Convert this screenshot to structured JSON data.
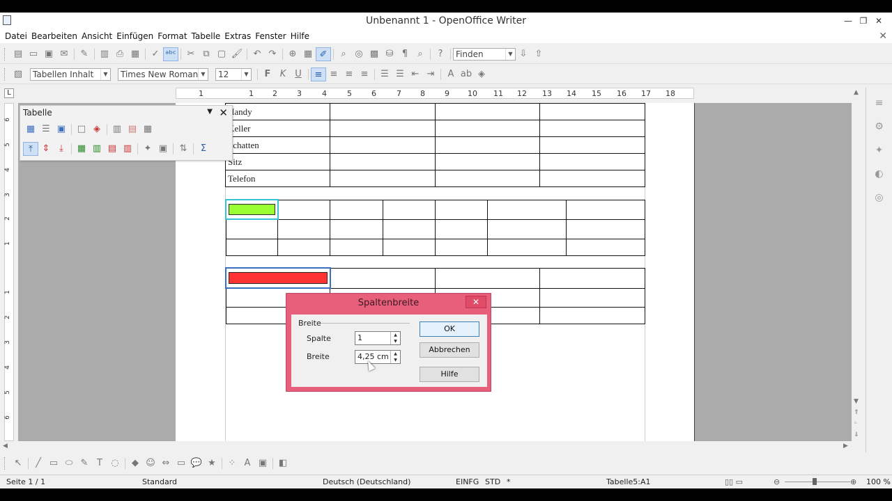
{
  "window": {
    "title": "Unbenannt 1 - OpenOffice Writer",
    "minimize": "—",
    "restore": "❐",
    "close": "✕"
  },
  "menu": [
    "Datei",
    "Bearbeiten",
    "Ansicht",
    "Einfügen",
    "Format",
    "Tabelle",
    "Extras",
    "Fenster",
    "Hilfe"
  ],
  "menu_close": "✕",
  "toolbar_standard": {
    "find_placeholder": "Finden"
  },
  "toolbar_format": {
    "style": "Tabellen Inhalt",
    "font": "Times New Roman",
    "size": "12",
    "bold": "F",
    "italic": "K",
    "underline": "U"
  },
  "ruler": {
    "corner": "L",
    "ticks": [
      "1",
      "1",
      "2",
      "3",
      "4",
      "5",
      "6",
      "7",
      "8",
      "9",
      "10",
      "11",
      "12",
      "13",
      "14",
      "15",
      "16",
      "17",
      "18"
    ],
    "vticks": [
      "6",
      "5",
      "4",
      "3",
      "2",
      "1",
      "1",
      "2",
      "3",
      "4",
      "5",
      "6"
    ]
  },
  "table1": {
    "rows": [
      "Handy",
      "Keller",
      "Schatten",
      "Sitz",
      "Telefon"
    ]
  },
  "floating_toolbar": {
    "title": "Tabelle"
  },
  "dialog": {
    "title": "Spaltenbreite",
    "close": "✕",
    "group": "Breite",
    "column_label": "Spalte",
    "column_value": "1",
    "width_label": "Breite",
    "width_value": "4,25 cm",
    "ok": "OK",
    "cancel": "Abbrechen",
    "help": "Hilfe"
  },
  "status": {
    "page": "Seite 1 / 1",
    "style": "Standard",
    "language": "Deutsch (Deutschland)",
    "insert": "EINFG",
    "selection": "STD",
    "modified": "*",
    "cell": "Tabelle5:A1",
    "zoom": "100 %"
  },
  "colors": {
    "green_cell": "#99ff33",
    "red_cell": "#ff3333",
    "dialog_frame": "#e85f7b"
  }
}
